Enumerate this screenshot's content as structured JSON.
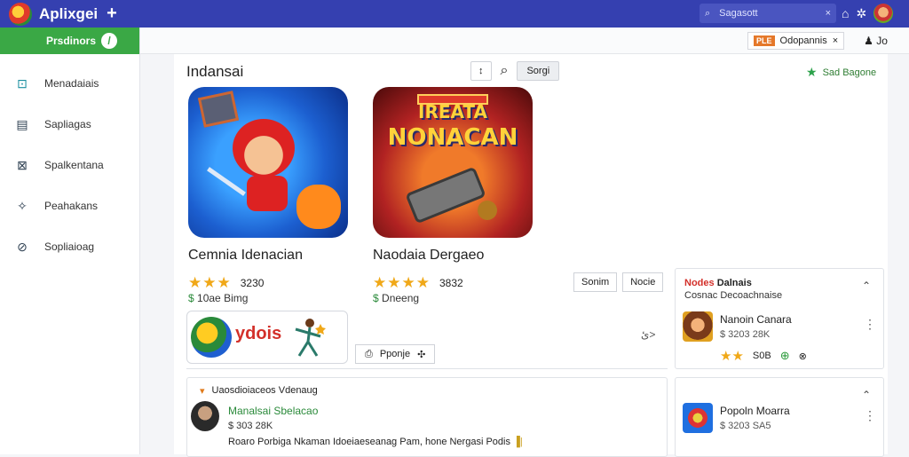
{
  "topbar": {
    "app_title": "Aplixgei",
    "plus": "+",
    "search_placeholder": "Sagasott",
    "search_close": "×"
  },
  "subbar": {
    "badge": "PLE",
    "notif_text": "Odopannis",
    "notif_close": "×",
    "user_label": "Jo"
  },
  "sidebar": {
    "header_label": "Prsdinors",
    "header_action": "/",
    "items": [
      {
        "label": "Menadaiais"
      },
      {
        "label": "Sapliagas"
      },
      {
        "label": "Spalkentana"
      },
      {
        "label": "Peahakans"
      },
      {
        "label": "Sopliaioag"
      }
    ]
  },
  "main": {
    "page_title": "Indansai",
    "toolbar": {
      "filter": "↕",
      "search": "⌕",
      "sort": "Sorgi"
    },
    "top_right_link": "Sad Bagone"
  },
  "games": [
    {
      "title": "Cemnia Idenacian",
      "rating": 3,
      "count": "3230",
      "sub_prefix": "$",
      "sub_num": "10ae",
      "sub_text": "Bimg"
    },
    {
      "title": "Naodaia Dergaeo",
      "rating": 4,
      "count": "3832",
      "sub_prefix": "$",
      "sub_num": "",
      "sub_text": "Dneeng"
    }
  ],
  "art": {
    "word1": "IREATA",
    "word2": "NONACAN",
    "banner": "RACIAL"
  },
  "buttons": {
    "b1": "Sonim",
    "b2": "Nocie"
  },
  "ad": {
    "text": "ydois",
    "page_indicator": "ئ>",
    "prepare_label": "Pponje",
    "prepare_icon": "✣"
  },
  "right_panel_1": {
    "head_red": "Nodes",
    "head_dark": "Dalnais",
    "subhead": "Cosnac Decoachnaise",
    "item": {
      "name": "Nanoin Canara",
      "meta": "$ 3203  28K"
    },
    "stars": "★★",
    "rating_num": "S0B"
  },
  "right_panel_2": {
    "item": {
      "name": "Popoln Moarra",
      "meta": "$ 3203  SA5"
    }
  },
  "comments": {
    "head_arrow": "▾",
    "head_text": "Uaosdioiaceos Vdenaug",
    "name": "Manalsai Sbelacao",
    "time": "$ 303  28K",
    "text": "Roaro Porbiga Nkaman Idoeiaeseanag Pam, hone Nergasi Podis"
  }
}
